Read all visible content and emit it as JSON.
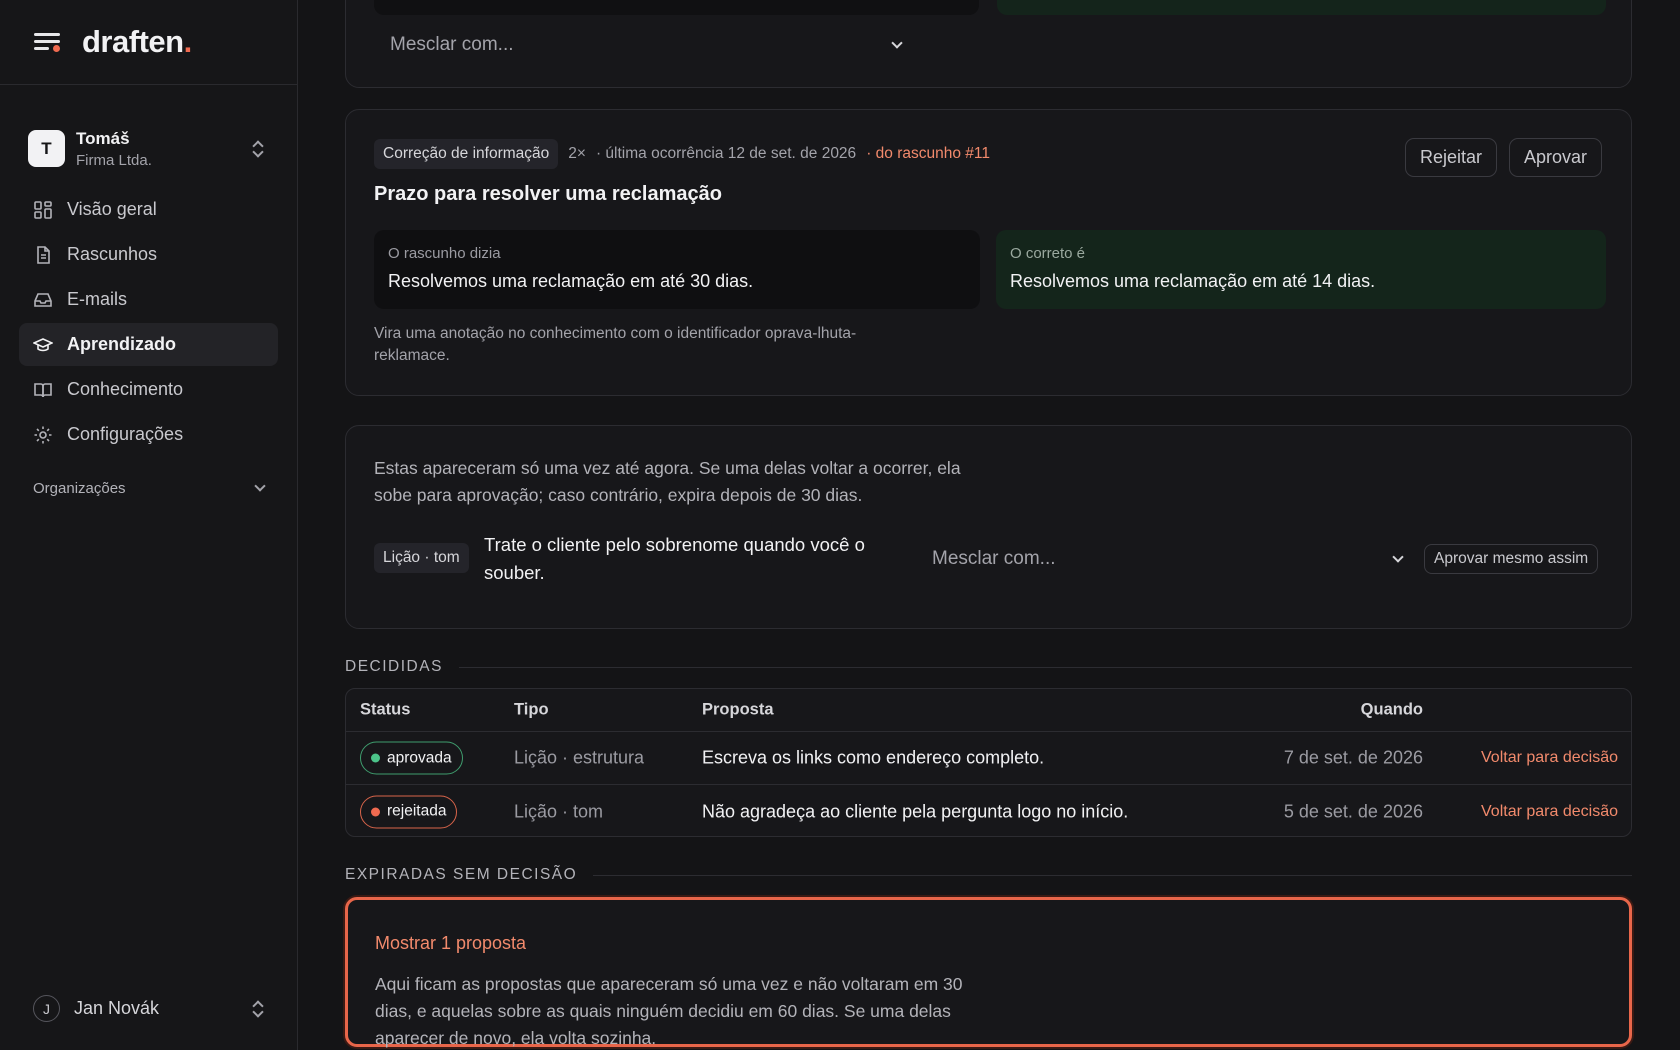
{
  "brand": {
    "name": "draften",
    "dot": "."
  },
  "workspace": {
    "initial": "T",
    "name": "Tomáš",
    "company": "Firma Ltda."
  },
  "nav": {
    "items": [
      {
        "label": "Visão geral",
        "icon": "grid-icon"
      },
      {
        "label": "Rascunhos",
        "icon": "document-icon"
      },
      {
        "label": "E-mails",
        "icon": "inbox-icon"
      },
      {
        "label": "Aprendizado",
        "icon": "graduation-cap-icon",
        "active": true
      },
      {
        "label": "Conhecimento",
        "icon": "book-icon"
      },
      {
        "label": "Configurações",
        "icon": "gear-icon"
      }
    ],
    "organizations": "Organizações"
  },
  "user": {
    "initial": "J",
    "name": "Jan Novák"
  },
  "top_card": {
    "merge_placeholder": "Mesclar com..."
  },
  "correction": {
    "tag": "Correção de informação",
    "count": "2×",
    "last": "· última ocorrência 12 de set. de 2026",
    "source": "· do rascunho #11",
    "title": "Prazo para resolver uma reclamação",
    "reject": "Rejeitar",
    "approve": "Aprovar",
    "draft_label": "O rascunho dizia",
    "draft_text": "Resolvemos uma reclamação em até 30 dias.",
    "correct_label": "O correto é",
    "correct_text": "Resolvemos uma reclamação em até 14 dias.",
    "note": "Vira uma anotação no conhecimento com o identificador oprava-lhuta-reklamace."
  },
  "pending": {
    "intro": "Estas apareceram só uma vez até agora. Se uma delas voltar a ocorrer, ela sobe para aprovação; caso contrário, expira depois de 30 dias.",
    "tag": "Lição · tom",
    "text": "Trate o cliente pelo sobrenome quando você o souber.",
    "merge_placeholder": "Mesclar com...",
    "approve_anyway": "Aprovar mesmo assim"
  },
  "decided": {
    "heading": "DECIDIDAS",
    "columns": {
      "status": "Status",
      "type": "Tipo",
      "proposal": "Proposta",
      "when": "Quando"
    },
    "rows": [
      {
        "status": "aprovada",
        "type": "Lição · estrutura",
        "proposal": "Escreva os links como endereço completo.",
        "when": "7 de set. de 2026",
        "action": "Voltar para decisão"
      },
      {
        "status": "rejeitada",
        "type": "Lição · tom",
        "proposal": "Não agradeça ao cliente pela pergunta logo no início.",
        "when": "5 de set. de 2026",
        "action": "Voltar para decisão"
      }
    ]
  },
  "expired": {
    "heading": "EXPIRADAS SEM DECISÃO",
    "show": "Mostrar 1 proposta",
    "text": "Aqui ficam as propostas que apareceram só uma vez e não voltaram em 30 dias, e aquelas sobre as quais ninguém decidiu em 60 dias. Se uma delas aparecer de novo, ela volta sozinha."
  },
  "colors": {
    "accent": "#f06a50",
    "approved": "#4cc48a",
    "background": "#141416"
  }
}
